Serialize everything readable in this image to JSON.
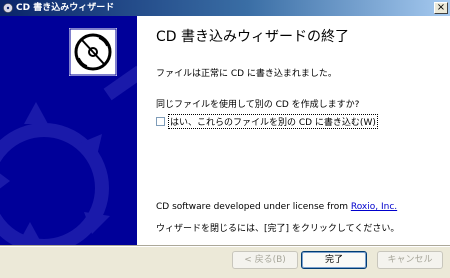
{
  "window": {
    "title": "CD 書き込みウィザード",
    "close_glyph": "×"
  },
  "content": {
    "heading": "CD 書き込みウィザードの終了",
    "line1": "ファイルは正常に CD に書き込まれました。",
    "line2": "同じファイルを使用して別の CD を作成しますか?",
    "checkbox": {
      "label": "はい、これらのファイルを別の CD に書き込む(W)",
      "checked": false
    },
    "license_prefix": "CD software developed under license from ",
    "license_link": "Roxio, Inc.",
    "finish_hint": "ウィザードを閉じるには、[完了] をクリックしてください。"
  },
  "buttons": {
    "back": "< 戻る(B)",
    "finish": "完了",
    "cancel": "キャンセル"
  },
  "icons": [
    "cd-burn-icon",
    "close-icon",
    "checkbox-icon",
    "wizard-graphic"
  ]
}
